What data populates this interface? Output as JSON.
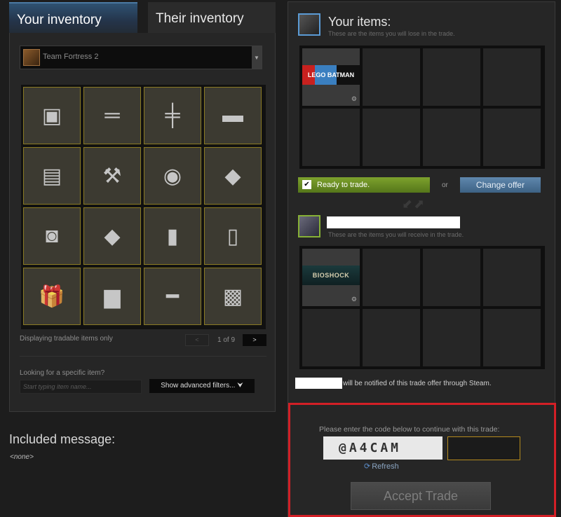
{
  "tabs": {
    "your_inventory": "Your inventory",
    "their_inventory": "Their inventory"
  },
  "game_select": {
    "selected": "Team Fortress 2"
  },
  "inventory": {
    "items": [
      {
        "name": "robot-part-icon",
        "glyph": "▣"
      },
      {
        "name": "rifle-icon",
        "glyph": "═"
      },
      {
        "name": "crossbow-icon",
        "glyph": "╪"
      },
      {
        "name": "launcher-icon",
        "glyph": "▬"
      },
      {
        "name": "casters-book-icon",
        "glyph": "▤"
      },
      {
        "name": "shovel-icon",
        "glyph": "⚒"
      },
      {
        "name": "robot-crate-icon",
        "glyph": "◉"
      },
      {
        "name": "red-crate-icon",
        "glyph": "◆"
      },
      {
        "name": "gift-box-open-icon",
        "glyph": "◙"
      },
      {
        "name": "red-crate-icon",
        "glyph": "◆"
      },
      {
        "name": "boots-icon",
        "glyph": "▮"
      },
      {
        "name": "tool-icon",
        "glyph": "▯"
      },
      {
        "name": "gift-icon",
        "glyph": "🎁"
      },
      {
        "name": "grenade-launcher-icon",
        "glyph": "▆"
      },
      {
        "name": "sniper-rifle-icon",
        "glyph": "━"
      },
      {
        "name": "minigun-icon",
        "glyph": "▩"
      }
    ],
    "display_note": "Displaying tradable items only",
    "pager": {
      "prev": "<",
      "text": "1 of 9",
      "next": ">"
    },
    "search_label": "Looking for a specific item?",
    "search_placeholder": "Start typing item name...",
    "advanced_filters": "Show advanced filters... ⮟"
  },
  "message": {
    "title": "Included message:",
    "body": "<none>"
  },
  "your_items": {
    "title": "Your items:",
    "subtitle": "These are the items you will lose in the trade.",
    "item": {
      "label": "LEGO BATMAN"
    }
  },
  "actions": {
    "ready": "Ready to trade.",
    "or": "or",
    "change_offer": "Change offer"
  },
  "their_items": {
    "subtitle": "These are the items you will receive in the trade.",
    "item": {
      "label": "BIOSHOCK"
    }
  },
  "notice": "will be notified of this trade offer through Steam.",
  "captcha": {
    "prompt": "Please enter the code below to continue with this trade:",
    "code": "@A4CAM",
    "refresh": "Refresh"
  },
  "accept_button": "Accept Trade",
  "colors": {
    "accent_blue": "#5b9bd5",
    "ready_green": "#7da22d",
    "highlight_red": "#d21f26",
    "slot_gold": "#8a7a23"
  }
}
